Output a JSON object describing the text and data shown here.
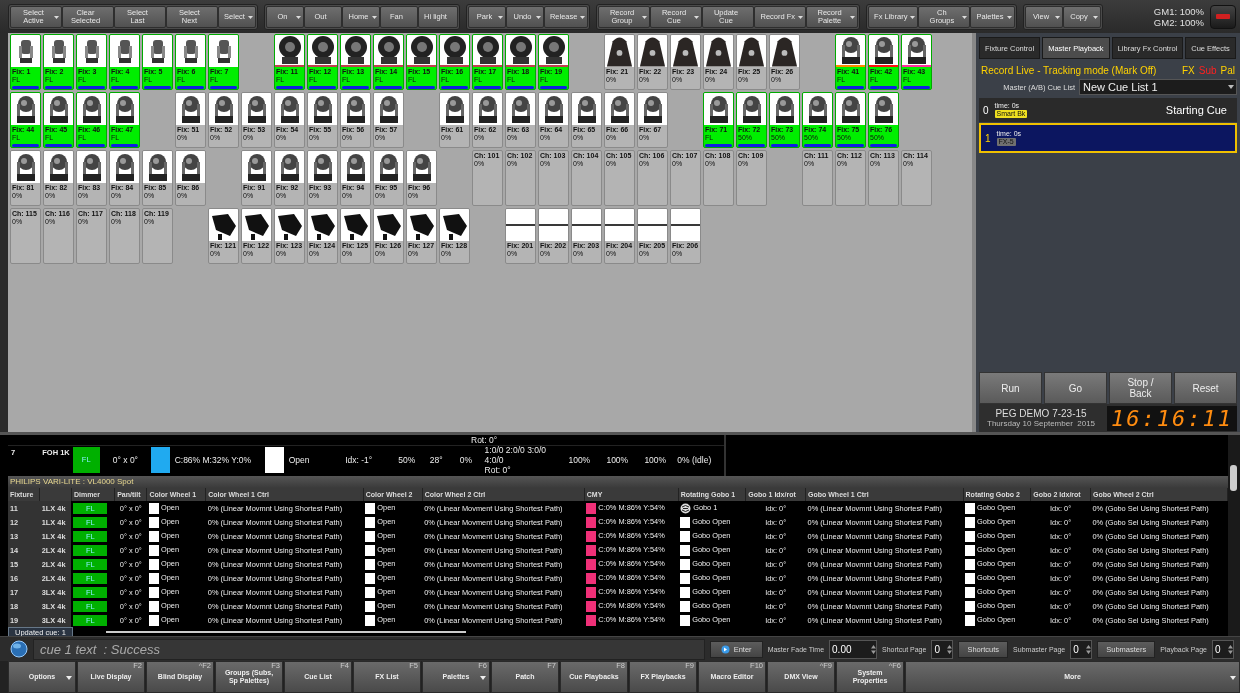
{
  "toolbar": {
    "groups": [
      [
        {
          "label": "Select Active",
          "menu": true
        },
        {
          "label": "Clear Selected",
          "menu": false
        },
        {
          "label": "Select Last",
          "menu": false
        },
        {
          "label": "Select Next",
          "menu": false
        },
        {
          "label": "Select",
          "menu": true
        }
      ],
      [
        {
          "label": "On",
          "menu": true
        },
        {
          "label": "Out",
          "menu": false
        },
        {
          "label": "Home",
          "menu": true
        },
        {
          "label": "Fan",
          "menu": false
        },
        {
          "label": "Hi light",
          "menu": false
        }
      ],
      [
        {
          "label": "Park",
          "menu": true
        },
        {
          "label": "Undo",
          "menu": true
        },
        {
          "label": "Release",
          "menu": true
        }
      ],
      [
        {
          "label": "Record Group",
          "menu": true
        },
        {
          "label": "Record Cue",
          "menu": true
        },
        {
          "label": "Update Cue",
          "menu": false
        },
        {
          "label": "Record  Fx",
          "menu": true
        },
        {
          "label": "Record Palette",
          "menu": true
        }
      ],
      [
        {
          "label": "Fx Library",
          "menu": true
        },
        {
          "label": "Ch Groups",
          "menu": true
        },
        {
          "label": "Palettes",
          "menu": true
        }
      ],
      [
        {
          "label": "View",
          "menu": true
        },
        {
          "label": "Copy",
          "menu": true
        }
      ]
    ],
    "gm1": "GM1: 100%",
    "gm2": "GM2: 100%"
  },
  "fixture_grid": {
    "rows": [
      [
        {
          "kind": "spot",
          "label": "Fix: 1",
          "value": "FL",
          "selected": true
        },
        {
          "kind": "spot",
          "label": "Fix: 2",
          "value": "FL",
          "selected": true
        },
        {
          "kind": "spot",
          "label": "Fix: 3",
          "value": "FL",
          "selected": true
        },
        {
          "kind": "spot",
          "label": "Fix: 4",
          "value": "FL",
          "selected": true
        },
        {
          "kind": "spot",
          "label": "Fix: 5",
          "value": "FL",
          "selected": true
        },
        {
          "kind": "spot",
          "label": "Fix: 6",
          "value": "FL",
          "selected": true
        },
        {
          "kind": "spot",
          "label": "Fix: 7",
          "value": "FL",
          "selected": true
        },
        {
          "kind": "empty"
        },
        {
          "kind": "wash",
          "label": "Fix: 11",
          "value": "FL",
          "selected": true,
          "color": "#c04050"
        },
        {
          "kind": "wash",
          "label": "Fix: 12",
          "value": "FL",
          "selected": true,
          "color": "#c04050"
        },
        {
          "kind": "wash",
          "label": "Fix: 13",
          "value": "FL",
          "selected": true,
          "color": "#c04050"
        },
        {
          "kind": "wash",
          "label": "Fix: 14",
          "value": "FL",
          "selected": true,
          "color": "#c04050"
        },
        {
          "kind": "wash",
          "label": "Fix: 15",
          "value": "FL",
          "selected": true,
          "color": "#c04050"
        },
        {
          "kind": "wash",
          "label": "Fix: 16",
          "value": "FL",
          "selected": true,
          "color": "#c04050"
        },
        {
          "kind": "wash",
          "label": "Fix: 17",
          "value": "FL",
          "selected": true,
          "color": "#c04050"
        },
        {
          "kind": "wash",
          "label": "Fix: 18",
          "value": "FL",
          "selected": true,
          "color": "#c04050"
        },
        {
          "kind": "wash",
          "label": "Fix: 19",
          "value": "FL",
          "selected": true,
          "color": "#c04050"
        },
        {
          "kind": "empty"
        },
        {
          "kind": "strobe",
          "label": "Fix: 21",
          "value": "0%",
          "selected": false
        },
        {
          "kind": "strobe",
          "label": "Fix: 22",
          "value": "0%",
          "selected": false
        },
        {
          "kind": "strobe",
          "label": "Fix: 23",
          "value": "0%",
          "selected": false
        },
        {
          "kind": "strobe",
          "label": "Fix: 24",
          "value": "0%",
          "selected": false
        },
        {
          "kind": "strobe",
          "label": "Fix: 25",
          "value": "0%",
          "selected": false
        },
        {
          "kind": "strobe",
          "label": "Fix: 26",
          "value": "0%",
          "selected": false
        },
        {
          "kind": "empty"
        },
        {
          "kind": "mover",
          "label": "Fix: 41",
          "value": "FL",
          "selected": true,
          "color": "#ff8a00"
        },
        {
          "kind": "mover",
          "label": "Fix: 42",
          "value": "FL",
          "selected": true,
          "color": "#ff1010"
        },
        {
          "kind": "mover",
          "label": "Fix: 43",
          "value": "FL",
          "selected": true,
          "color": "#ff30a0"
        }
      ],
      [
        {
          "kind": "mover",
          "label": "Fix: 44",
          "value": "FL",
          "selected": true
        },
        {
          "kind": "mover",
          "label": "Fix: 45",
          "value": "FL",
          "selected": true
        },
        {
          "kind": "mover",
          "label": "Fix: 46",
          "value": "FL",
          "selected": true
        },
        {
          "kind": "mover",
          "label": "Fix: 47",
          "value": "FL",
          "selected": true
        },
        {
          "kind": "empty"
        },
        {
          "kind": "mover",
          "label": "Fix: 51",
          "value": "0%",
          "selected": false
        },
        {
          "kind": "mover",
          "label": "Fix: 52",
          "value": "0%",
          "selected": false
        },
        {
          "kind": "mover",
          "label": "Fix: 53",
          "value": "0%",
          "selected": false
        },
        {
          "kind": "mover",
          "label": "Fix: 54",
          "value": "0%",
          "selected": false
        },
        {
          "kind": "mover",
          "label": "Fix: 55",
          "value": "0%",
          "selected": false
        },
        {
          "kind": "mover",
          "label": "Fix: 56",
          "value": "0%",
          "selected": false
        },
        {
          "kind": "mover",
          "label": "Fix: 57",
          "value": "0%",
          "selected": false
        },
        {
          "kind": "empty"
        },
        {
          "kind": "mover",
          "label": "Fix: 61",
          "value": "0%",
          "selected": false
        },
        {
          "kind": "mover",
          "label": "Fix: 62",
          "value": "0%",
          "selected": false
        },
        {
          "kind": "mover",
          "label": "Fix: 63",
          "value": "0%",
          "selected": false
        },
        {
          "kind": "mover",
          "label": "Fix: 64",
          "value": "0%",
          "selected": false
        },
        {
          "kind": "mover",
          "label": "Fix: 65",
          "value": "0%",
          "selected": false
        },
        {
          "kind": "mover",
          "label": "Fix: 66",
          "value": "0%",
          "selected": false
        },
        {
          "kind": "mover",
          "label": "Fix: 67",
          "value": "0%",
          "selected": false
        },
        {
          "kind": "empty"
        },
        {
          "kind": "mover",
          "label": "Fix: 71",
          "value": "FL",
          "selected": true
        },
        {
          "kind": "mover",
          "label": "Fix: 72",
          "value": "50%",
          "selected": true
        },
        {
          "kind": "mover",
          "label": "Fix: 73",
          "value": "50%",
          "selected": true
        },
        {
          "kind": "mover",
          "label": "Fix: 74",
          "value": "50%",
          "selected": true
        },
        {
          "kind": "mover",
          "label": "Fix: 75",
          "value": "50%",
          "selected": true
        },
        {
          "kind": "mover",
          "label": "Fix: 76",
          "value": "50%",
          "selected": true
        }
      ],
      [
        {
          "kind": "mover",
          "label": "Fix: 81",
          "value": "0%",
          "selected": false
        },
        {
          "kind": "mover",
          "label": "Fix: 82",
          "value": "0%",
          "selected": false
        },
        {
          "kind": "mover",
          "label": "Fix: 83",
          "value": "0%",
          "selected": false
        },
        {
          "kind": "mover",
          "label": "Fix: 84",
          "value": "0%",
          "selected": false
        },
        {
          "kind": "mover",
          "label": "Fix: 85",
          "value": "0%",
          "selected": false
        },
        {
          "kind": "mover",
          "label": "Fix: 86",
          "value": "0%",
          "selected": false
        },
        {
          "kind": "empty"
        },
        {
          "kind": "mover",
          "label": "Fix: 91",
          "value": "0%",
          "selected": false
        },
        {
          "kind": "mover",
          "label": "Fix: 92",
          "value": "0%",
          "selected": false
        },
        {
          "kind": "mover",
          "label": "Fix: 93",
          "value": "0%",
          "selected": false
        },
        {
          "kind": "mover",
          "label": "Fix: 94",
          "value": "0%",
          "selected": false
        },
        {
          "kind": "mover",
          "label": "Fix: 95",
          "value": "0%",
          "selected": false
        },
        {
          "kind": "mover",
          "label": "Fix: 96",
          "value": "0%",
          "selected": false
        },
        {
          "kind": "empty"
        },
        {
          "kind": "channel",
          "label": "Ch: 101",
          "value": "0%",
          "selected": false
        },
        {
          "kind": "channel",
          "label": "Ch: 102",
          "value": "0%",
          "selected": false
        },
        {
          "kind": "channel",
          "label": "Ch: 103",
          "value": "0%",
          "selected": false
        },
        {
          "kind": "channel",
          "label": "Ch: 104",
          "value": "0%",
          "selected": false
        },
        {
          "kind": "channel",
          "label": "Ch: 105",
          "value": "0%",
          "selected": false
        },
        {
          "kind": "channel",
          "label": "Ch: 106",
          "value": "0%",
          "selected": false
        },
        {
          "kind": "channel",
          "label": "Ch: 107",
          "value": "0%",
          "selected": false
        },
        {
          "kind": "channel",
          "label": "Ch: 108",
          "value": "0%",
          "selected": false
        },
        {
          "kind": "channel",
          "label": "Ch: 109",
          "value": "0%",
          "selected": false
        },
        {
          "kind": "empty"
        },
        {
          "kind": "channel",
          "label": "Ch: 111",
          "value": "0%",
          "selected": false
        },
        {
          "kind": "channel",
          "label": "Ch: 112",
          "value": "0%",
          "selected": false
        },
        {
          "kind": "channel",
          "label": "Ch: 113",
          "value": "0%",
          "selected": false
        },
        {
          "kind": "channel",
          "label": "Ch: 114",
          "value": "0%",
          "selected": false
        }
      ],
      [
        {
          "kind": "channel",
          "label": "Ch: 115",
          "value": "0%",
          "selected": false
        },
        {
          "kind": "channel",
          "label": "Ch: 116",
          "value": "0%",
          "selected": false
        },
        {
          "kind": "channel",
          "label": "Ch: 117",
          "value": "0%",
          "selected": false
        },
        {
          "kind": "channel",
          "label": "Ch: 118",
          "value": "0%",
          "selected": false
        },
        {
          "kind": "channel",
          "label": "Ch: 119",
          "value": "0%",
          "selected": false
        },
        {
          "kind": "empty"
        },
        {
          "kind": "profile",
          "label": "Fix: 121",
          "value": "0%",
          "selected": false
        },
        {
          "kind": "profile",
          "label": "Fix: 122",
          "value": "0%",
          "selected": false
        },
        {
          "kind": "profile",
          "label": "Fix: 123",
          "value": "0%",
          "selected": false
        },
        {
          "kind": "profile",
          "label": "Fix: 124",
          "value": "0%",
          "selected": false
        },
        {
          "kind": "profile",
          "label": "Fix: 125",
          "value": "0%",
          "selected": false
        },
        {
          "kind": "profile",
          "label": "Fix: 126",
          "value": "0%",
          "selected": false
        },
        {
          "kind": "profile",
          "label": "Fix: 127",
          "value": "0%",
          "selected": false
        },
        {
          "kind": "profile",
          "label": "Fix: 128",
          "value": "0%",
          "selected": false
        },
        {
          "kind": "empty"
        },
        {
          "kind": "batten",
          "label": "Fix: 201",
          "value": "0%",
          "selected": false
        },
        {
          "kind": "batten",
          "label": "Fix: 202",
          "value": "0%",
          "selected": false
        },
        {
          "kind": "batten",
          "label": "Fix: 203",
          "value": "0%",
          "selected": false
        },
        {
          "kind": "batten",
          "label": "Fix: 204",
          "value": "0%",
          "selected": false
        },
        {
          "kind": "batten",
          "label": "Fix: 205",
          "value": "0%",
          "selected": false
        },
        {
          "kind": "batten",
          "label": "Fix: 206",
          "value": "0%",
          "selected": false
        }
      ]
    ]
  },
  "playback_panel": {
    "tabs": [
      {
        "label": "Fixture Control",
        "selected": false
      },
      {
        "label": "Master Playback",
        "selected": true
      },
      {
        "label": "Library Fx Control",
        "selected": false
      },
      {
        "label": "Cue Effects",
        "selected": false
      }
    ],
    "mode": "Record Live - Tracking mode (Mark Off)",
    "flags": [
      {
        "label": "FX",
        "on": true
      },
      {
        "label": "Sub",
        "on": false
      },
      {
        "label": "Pal",
        "on": true
      }
    ],
    "cue_list_label": "Master (A/B) Cue List",
    "cue_list": "New Cue List 1",
    "cues": [
      {
        "number": "0",
        "time": "time: 0s",
        "tag": "Smart Bk",
        "color": "#f0e020",
        "name": "Starting Cue",
        "selected": false
      },
      {
        "number": "1",
        "time": "time: 0s",
        "tag": "FX-5",
        "color": "#707070",
        "selected": true
      }
    ],
    "buttons": [
      "Run",
      "Go",
      "Stop / Back",
      "Reset"
    ],
    "show_name": "PEG DEMO 7-23-15",
    "date": "Thursday 10 September  2015",
    "clock": "16:16:11"
  },
  "upper_table": {
    "clipped_text": "Rot: 0°",
    "row": {
      "fixture": "7",
      "type": "FOH 1K",
      "dimmer": "FL",
      "pan_tilt": "0° x 0°",
      "color": "#20aaf0",
      "cmy": "C:86% M:32% Y:0%",
      "gobo": "Open",
      "index": "Idx: -1°",
      "cells": [
        "50%",
        "28°",
        "0%"
      ],
      "gobo_positions": "1:0/0 2:0/0 3:0/0 4:0/0",
      "rotation": "Rot: 0°",
      "levels": [
        "100%",
        "100%",
        "100%"
      ],
      "state": "0% (Idle)"
    }
  },
  "fixture_table": {
    "group": "PHILIPS VARI-LITE : VL4000 Spot",
    "columns": [
      "Fixture",
      "Dimmer",
      "Pan/tilt",
      "Color Wheel 1",
      "Color Wheel 1 Ctrl",
      "Color Wheel 2",
      "Color Wheel 2 Ctrl",
      "CMY",
      "Rotating Gobo 1",
      "Gobo 1 Idx/rot",
      "Gobo Wheel 1 Ctrl",
      "Rotating Gobo 2",
      "Gobo 2 Idx/rot",
      "Gobo Wheel 2 Ctrl"
    ],
    "rows": [
      {
        "fixture": "11",
        "type": "1LX 4k",
        "dimmer": "FL",
        "pan_tilt": "0° x 0°",
        "color_wheel_1": "Open",
        "color_wheel_1_ctrl": "0% (Linear Movmnt Using Shortest Path)",
        "color_wheel_2": "Open",
        "color_wheel_2_ctrl": "0% (Linear Movment Using Shortest Path)",
        "cmy": "C:0% M:86% Y:54%",
        "color": "#f03078",
        "rotating_gobo_1": "Gobo 1",
        "gobo_1_patterned": true,
        "gobo_1_idx": "Idx: 0°",
        "gobo_wheel_1_ctrl": "0% (Linear Movmnt Using Shortest Path)",
        "rotating_gobo_2": "Gobo Open",
        "gobo_2_idx": "Idx: 0°",
        "gobo_wheel_2_ctrl": "0% (Gobo Sel Using Shortest Path)"
      },
      {
        "fixture": "12",
        "type": "1LX 4k",
        "dimmer": "FL",
        "pan_tilt": "0° x 0°",
        "color_wheel_1": "Open",
        "color_wheel_1_ctrl": "0% (Linear Movmnt Using Shortest Path)",
        "color_wheel_2": "Open",
        "color_wheel_2_ctrl": "0% (Linear Movment Using Shortest Path)",
        "cmy": "C:0% M:86% Y:54%",
        "color": "#f03078",
        "rotating_gobo_1": "Gobo Open",
        "gobo_1_patterned": false,
        "gobo_1_idx": "Idx: 0°",
        "gobo_wheel_1_ctrl": "0% (Linear Movmnt Using Shortest Path)",
        "rotating_gobo_2": "Gobo Open",
        "gobo_2_idx": "Idx: 0°",
        "gobo_wheel_2_ctrl": "0% (Gobo Sel Using Shortest Path)"
      },
      {
        "fixture": "13",
        "type": "1LX 4k",
        "dimmer": "FL",
        "pan_tilt": "0° x 0°",
        "color_wheel_1": "Open",
        "color_wheel_1_ctrl": "0% (Linear Movmnt Using Shortest Path)",
        "color_wheel_2": "Open",
        "color_wheel_2_ctrl": "0% (Linear Movment Using Shortest Path)",
        "cmy": "C:0% M:86% Y:54%",
        "color": "#f03078",
        "rotating_gobo_1": "Gobo Open",
        "gobo_1_patterned": false,
        "gobo_1_idx": "Idx: 0°",
        "gobo_wheel_1_ctrl": "0% (Linear Movmnt Using Shortest Path)",
        "rotating_gobo_2": "Gobo Open",
        "gobo_2_idx": "Idx: 0°",
        "gobo_wheel_2_ctrl": "0% (Gobo Sel Using Shortest Path)"
      },
      {
        "fixture": "14",
        "type": "2LX 4k",
        "dimmer": "FL",
        "pan_tilt": "0° x 0°",
        "color_wheel_1": "Open",
        "color_wheel_1_ctrl": "0% (Linear Movmnt Using Shortest Path)",
        "color_wheel_2": "Open",
        "color_wheel_2_ctrl": "0% (Linear Movment Using Shortest Path)",
        "cmy": "C:0% M:86% Y:54%",
        "color": "#f03078",
        "rotating_gobo_1": "Gobo Open",
        "gobo_1_patterned": false,
        "gobo_1_idx": "Idx: 0°",
        "gobo_wheel_1_ctrl": "0% (Linear Movmnt Using Shortest Path)",
        "rotating_gobo_2": "Gobo Open",
        "gobo_2_idx": "Idx: 0°",
        "gobo_wheel_2_ctrl": "0% (Gobo Sel Using Shortest Path)"
      },
      {
        "fixture": "15",
        "type": "2LX 4k",
        "dimmer": "FL",
        "pan_tilt": "0° x 0°",
        "color_wheel_1": "Open",
        "color_wheel_1_ctrl": "0% (Linear Movmnt Using Shortest Path)",
        "color_wheel_2": "Open",
        "color_wheel_2_ctrl": "0% (Linear Movment Using Shortest Path)",
        "cmy": "C:0% M:86% Y:54%",
        "color": "#f03078",
        "rotating_gobo_1": "Gobo Open",
        "gobo_1_patterned": false,
        "gobo_1_idx": "Idx: 0°",
        "gobo_wheel_1_ctrl": "0% (Linear Movmnt Using Shortest Path)",
        "rotating_gobo_2": "Gobo Open",
        "gobo_2_idx": "Idx: 0°",
        "gobo_wheel_2_ctrl": "0% (Gobo Sel Using Shortest Path)"
      },
      {
        "fixture": "16",
        "type": "2LX 4k",
        "dimmer": "FL",
        "pan_tilt": "0° x 0°",
        "color_wheel_1": "Open",
        "color_wheel_1_ctrl": "0% (Linear Movmnt Using Shortest Path)",
        "color_wheel_2": "Open",
        "color_wheel_2_ctrl": "0% (Linear Movment Using Shortest Path)",
        "cmy": "C:0% M:86% Y:54%",
        "color": "#f03078",
        "rotating_gobo_1": "Gobo Open",
        "gobo_1_patterned": false,
        "gobo_1_idx": "Idx: 0°",
        "gobo_wheel_1_ctrl": "0% (Linear Movmnt Using Shortest Path)",
        "rotating_gobo_2": "Gobo Open",
        "gobo_2_idx": "Idx: 0°",
        "gobo_wheel_2_ctrl": "0% (Gobo Sel Using Shortest Path)"
      },
      {
        "fixture": "17",
        "type": "3LX 4k",
        "dimmer": "FL",
        "pan_tilt": "0° x 0°",
        "color_wheel_1": "Open",
        "color_wheel_1_ctrl": "0% (Linear Movmnt Using Shortest Path)",
        "color_wheel_2": "Open",
        "color_wheel_2_ctrl": "0% (Linear Movment Using Shortest Path)",
        "cmy": "C:0% M:86% Y:54%",
        "color": "#f03078",
        "rotating_gobo_1": "Gobo Open",
        "gobo_1_patterned": false,
        "gobo_1_idx": "Idx: 0°",
        "gobo_wheel_1_ctrl": "0% (Linear Movmnt Using Shortest Path)",
        "rotating_gobo_2": "Gobo Open",
        "gobo_2_idx": "Idx: 0°",
        "gobo_wheel_2_ctrl": "0% (Gobo Sel Using Shortest Path)"
      },
      {
        "fixture": "18",
        "type": "3LX 4k",
        "dimmer": "FL",
        "pan_tilt": "0° x 0°",
        "color_wheel_1": "Open",
        "color_wheel_1_ctrl": "0% (Linear Movmnt Using Shortest Path)",
        "color_wheel_2": "Open",
        "color_wheel_2_ctrl": "0% (Linear Movment Using Shortest Path)",
        "cmy": "C:0% M:86% Y:54%",
        "color": "#f03078",
        "rotating_gobo_1": "Gobo Open",
        "gobo_1_patterned": false,
        "gobo_1_idx": "Idx: 0°",
        "gobo_wheel_1_ctrl": "0% (Linear Movmnt Using Shortest Path)",
        "rotating_gobo_2": "Gobo Open",
        "gobo_2_idx": "Idx: 0°",
        "gobo_wheel_2_ctrl": "0% (Gobo Sel Using Shortest Path)"
      },
      {
        "fixture": "19",
        "type": "3LX 4k",
        "dimmer": "FL",
        "pan_tilt": "0° x 0°",
        "color_wheel_1": "Open",
        "color_wheel_1_ctrl": "0% (Linear Movmnt Using Shortest Path)",
        "color_wheel_2": "Open",
        "color_wheel_2_ctrl": "0% (Linear Movment Using Shortest Path)",
        "cmy": "C:0% M:86% Y:54%",
        "color": "#f03078",
        "rotating_gobo_1": "Gobo Open",
        "gobo_1_patterned": false,
        "gobo_1_idx": "Idx: 0°",
        "gobo_wheel_1_ctrl": "0% (Linear Movmnt Using Shortest Path)",
        "rotating_gobo_2": "Gobo Open",
        "gobo_2_idx": "Idx: 0°",
        "gobo_wheel_2_ctrl": "0% (Gobo Sel Using Shortest Path)"
      }
    ],
    "notice": "Updated cue: 1"
  },
  "command_bar": {
    "text": "cue 1 text  : Success",
    "enter": "Enter",
    "fade_label": "Master Fade Time",
    "fade_value": "0.00",
    "shortcut_page_label": "Shortcut Page",
    "shortcut_page": "0",
    "shortcuts": "Shortcuts",
    "submaster_page_label": "Submaster Page",
    "submaster_page": "0",
    "submasters": "Submasters",
    "playback_page_label": "Playback Page",
    "playback_page": "0"
  },
  "function_bar": [
    {
      "label": "Options",
      "menu": true
    },
    {
      "label": "Live Display",
      "key": "F2",
      "menu": false
    },
    {
      "label": "Blind Display",
      "key": "^F2",
      "menu": false
    },
    {
      "label": "Groups (Subs, Sp Palettes)",
      "key": "F3",
      "menu": false
    },
    {
      "label": "Cue List",
      "key": "F4",
      "menu": false
    },
    {
      "label": "FX List",
      "key": "F5",
      "menu": false
    },
    {
      "label": "Palettes",
      "key": "F6",
      "menu": true
    },
    {
      "label": "Patch",
      "key": "F7",
      "menu": false
    },
    {
      "label": "Cue Playbacks",
      "key": "F8",
      "menu": false
    },
    {
      "label": "FX Playbacks",
      "key": "F9",
      "menu": false
    },
    {
      "label": "Macro Editor",
      "key": "F10",
      "menu": false
    },
    {
      "label": "DMX View",
      "key": "^F9",
      "menu": false
    },
    {
      "label": "System Properties",
      "key": "^F6",
      "menu": false
    },
    {
      "label": "More",
      "menu": true
    }
  ]
}
